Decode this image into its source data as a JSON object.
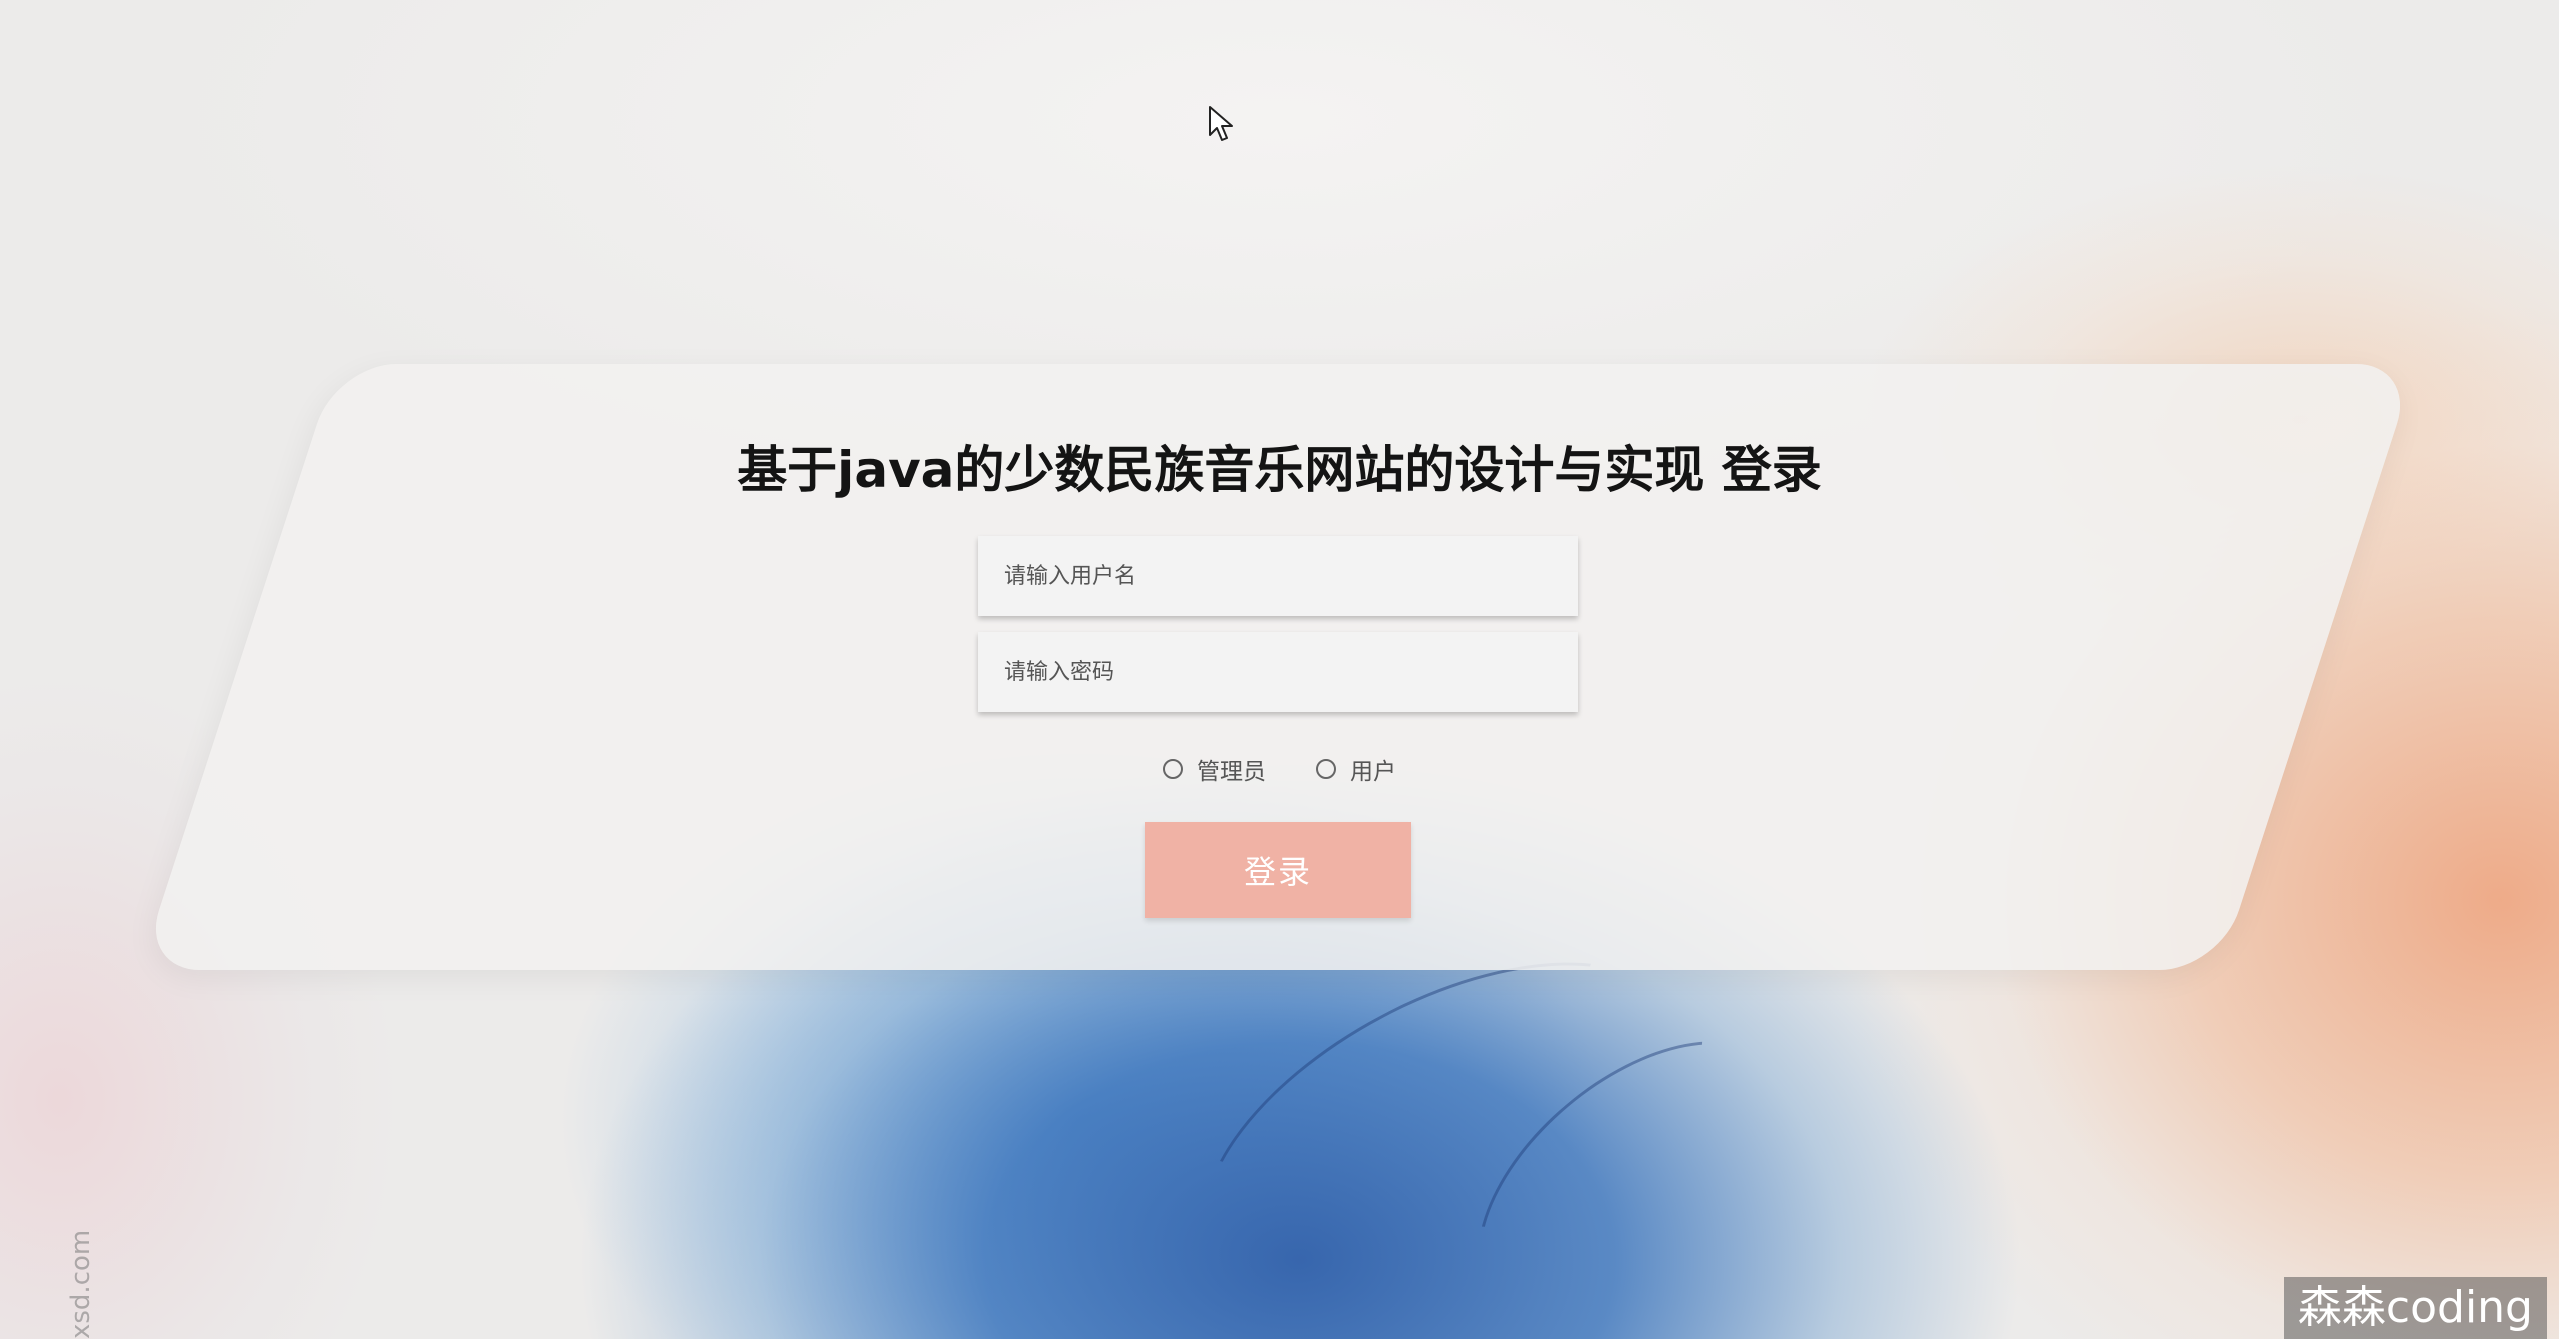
{
  "page": {
    "title": "基于java的少数民族音乐网站的设计与实现 登录"
  },
  "form": {
    "username_placeholder": "请输入用户名",
    "password_placeholder": "请输入密码",
    "roles": [
      {
        "label": "管理员",
        "selected": false
      },
      {
        "label": "用户",
        "selected": false
      }
    ],
    "login_label": "登录"
  },
  "overlay": {
    "watermark": "森森coding",
    "side_watermark": "xsd.com"
  },
  "colors": {
    "login_button": "#f0b2a5",
    "title_text": "#141414"
  }
}
